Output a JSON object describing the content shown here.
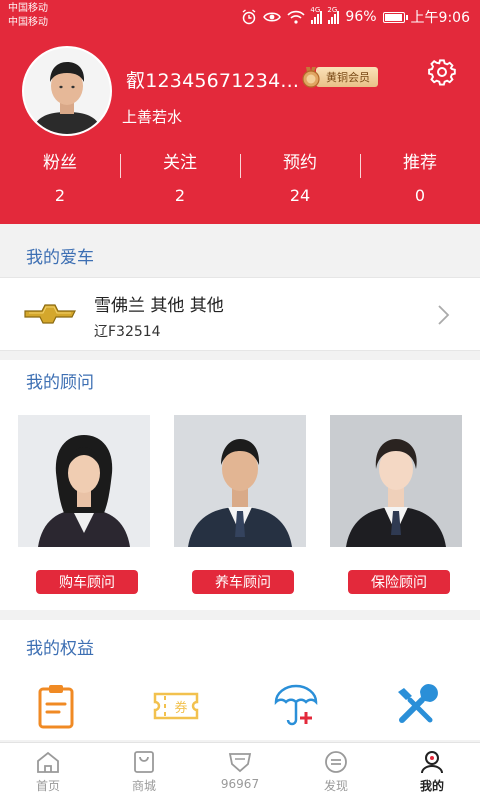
{
  "status_bar": {
    "carrier_1": "中国移动",
    "carrier_2": "中国移动",
    "network_tag_1": "4G",
    "network_tag_2": "2G",
    "battery": "96%",
    "time": "上午9:06"
  },
  "profile": {
    "username": "叡12345671234...",
    "member_level": "黄铜会员",
    "signature": "上善若水",
    "stats": [
      {
        "label": "粉丝",
        "value": "2"
      },
      {
        "label": "关注",
        "value": "2"
      },
      {
        "label": "预约",
        "value": "24"
      },
      {
        "label": "推荐",
        "value": "0"
      }
    ]
  },
  "my_car": {
    "title": "我的爱车",
    "brand_icon": "chevrolet-logo-icon",
    "name": "雪佛兰 其他 其他",
    "plate": "辽F32514"
  },
  "advisors": {
    "title": "我的顾问",
    "items": [
      {
        "button": "购车顾问"
      },
      {
        "button": "养车顾问"
      },
      {
        "button": "保险顾问"
      }
    ]
  },
  "rights": {
    "title": "我的权益",
    "icons": [
      "clipboard-icon",
      "coupon-icon",
      "insurance-umbrella-icon",
      "tools-icon"
    ]
  },
  "tabs": [
    {
      "label": "首页",
      "icon": "home-icon",
      "active": false
    },
    {
      "label": "商城",
      "icon": "shop-bag-icon",
      "active": false
    },
    {
      "label": "96967",
      "icon": "shield-badge-icon",
      "active": false
    },
    {
      "label": "发现",
      "icon": "discover-icon",
      "active": false
    },
    {
      "label": "我的",
      "icon": "profile-icon",
      "active": true
    }
  ],
  "colors": {
    "brand_red": "#e3293b",
    "section_blue": "#3d6fb3",
    "icon_orange": "#f08a24",
    "icon_blue": "#2a8fd8"
  }
}
